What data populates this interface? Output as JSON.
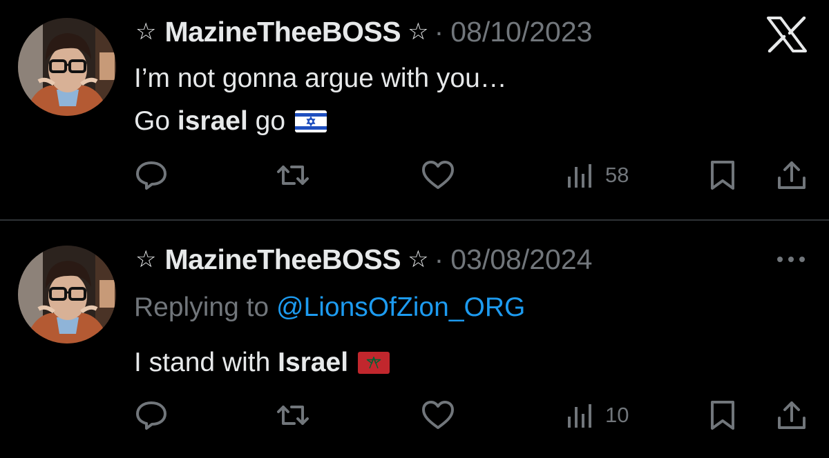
{
  "platform_logo": "X",
  "colors": {
    "background": "#000000",
    "text": "#e7e9ea",
    "muted": "#71767b",
    "link": "#1d9bf0",
    "divider": "#2f3336"
  },
  "tweets": [
    {
      "display_name": "MazineTheeBOSS",
      "name_prefix": "☆",
      "name_suffix": "☆",
      "separator": "·",
      "date": "08/10/2023",
      "text_line_1": "I’m not gonna argue with you…",
      "text_line_2_before": "Go ",
      "text_line_2_bold": "israel",
      "text_line_2_after": " go",
      "flag_icon": "israel-flag-icon",
      "actions": {
        "reply_icon": "reply-icon",
        "repost_icon": "repost-icon",
        "like_icon": "heart-icon",
        "views_icon": "views-icon",
        "views_count": "58",
        "bookmark_icon": "bookmark-icon",
        "share_icon": "share-icon"
      },
      "corner_icon": "x-logo-icon"
    },
    {
      "display_name": "MazineTheeBOSS",
      "name_prefix": "☆",
      "name_suffix": "☆",
      "separator": "·",
      "date": "03/08/2024",
      "replying_to_label": "Replying to ",
      "replying_to_handle": "@LionsOfZion_ORG",
      "text_before": "I stand with ",
      "text_bold": "Israel",
      "flag_icon": "morocco-flag-icon",
      "actions": {
        "reply_icon": "reply-icon",
        "repost_icon": "repost-icon",
        "like_icon": "heart-icon",
        "views_icon": "views-icon",
        "views_count": "10",
        "bookmark_icon": "bookmark-icon",
        "share_icon": "share-icon"
      },
      "corner_icon": "more-icon"
    }
  ]
}
